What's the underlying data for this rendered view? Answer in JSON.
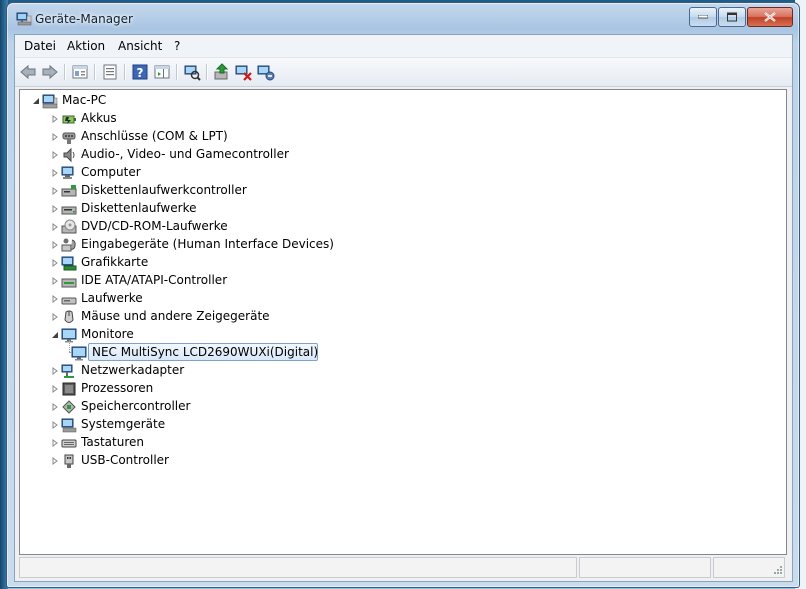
{
  "window": {
    "title": "Geräte-Manager"
  },
  "menu": {
    "items": [
      "Datei",
      "Aktion",
      "Ansicht",
      "?"
    ]
  },
  "toolbar": {
    "buttons": [
      "back-icon",
      "forward-icon",
      "properties-view-icon",
      "console-tree-icon",
      "help-icon",
      "action-pane-icon",
      "scan-hardware-icon",
      "update-driver-icon",
      "disable-device-icon",
      "uninstall-device-icon"
    ]
  },
  "tree": {
    "root": "Mac-PC",
    "categories": [
      {
        "label": "Akkus",
        "icon": "battery-icon"
      },
      {
        "label": "Anschlüsse (COM & LPT)",
        "icon": "port-icon"
      },
      {
        "label": "Audio-, Video- und Gamecontroller",
        "icon": "speaker-icon"
      },
      {
        "label": "Computer",
        "icon": "computer-icon"
      },
      {
        "label": "Diskettenlaufwerkcontroller",
        "icon": "floppy-controller-icon"
      },
      {
        "label": "Diskettenlaufwerke",
        "icon": "floppy-drive-icon"
      },
      {
        "label": "DVD/CD-ROM-Laufwerke",
        "icon": "dvd-drive-icon"
      },
      {
        "label": "Eingabegeräte (Human Interface Devices)",
        "icon": "hid-icon"
      },
      {
        "label": "Grafikkarte",
        "icon": "display-adapter-icon"
      },
      {
        "label": "IDE ATA/ATAPI-Controller",
        "icon": "ide-controller-icon"
      },
      {
        "label": "Laufwerke",
        "icon": "disk-drive-icon"
      },
      {
        "label": "Mäuse und andere Zeigegeräte",
        "icon": "mouse-icon"
      },
      {
        "label": "Monitore",
        "icon": "monitor-icon",
        "expanded": true,
        "children": [
          {
            "label": "NEC MultiSync LCD2690WUXi(Digital)",
            "icon": "monitor-icon",
            "selected": true
          }
        ]
      },
      {
        "label": "Netzwerkadapter",
        "icon": "network-adapter-icon"
      },
      {
        "label": "Prozessoren",
        "icon": "processor-icon"
      },
      {
        "label": "Speichercontroller",
        "icon": "storage-controller-icon"
      },
      {
        "label": "Systemgeräte",
        "icon": "system-device-icon"
      },
      {
        "label": "Tastaturen",
        "icon": "keyboard-icon"
      },
      {
        "label": "USB-Controller",
        "icon": "usb-icon"
      }
    ]
  },
  "statusbar": {
    "text": ""
  }
}
